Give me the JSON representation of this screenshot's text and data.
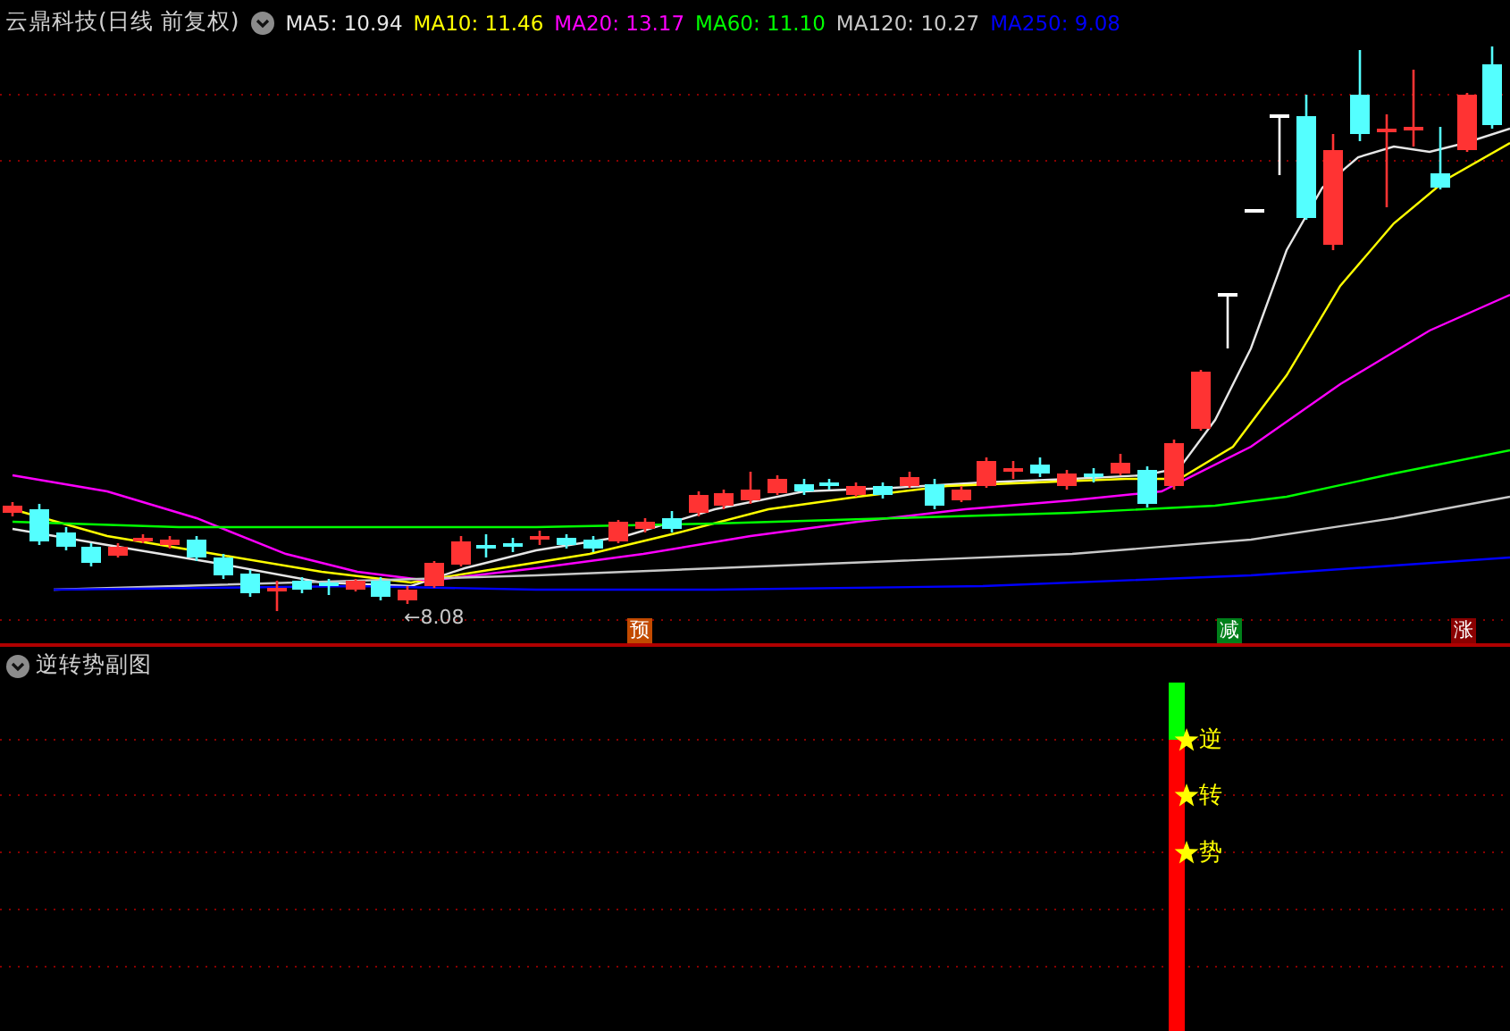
{
  "chart_title": "云鼎科技(日线 前复权)",
  "legend": [
    {
      "label": "MA5: 10.94",
      "color": "#e6e6e6"
    },
    {
      "label": "MA10: 11.46",
      "color": "#ffff00"
    },
    {
      "label": "MA20: 13.17",
      "color": "#ff00ff"
    },
    {
      "label": "MA60: 11.10",
      "color": "#00ff00"
    },
    {
      "label": "MA120: 10.27",
      "color": "#c8c8c8"
    },
    {
      "label": "MA250: 9.08",
      "color": "#0000ff"
    }
  ],
  "low_label": "←8.08",
  "markers": [
    {
      "label": "预",
      "color": "#c24a00"
    },
    {
      "label": "减",
      "color": "#00801a"
    },
    {
      "label": "涨",
      "color": "#8a0000"
    }
  ],
  "sub_chart": {
    "title": "逆转势副图",
    "signals": [
      {
        "label": "逆"
      },
      {
        "label": "转"
      },
      {
        "label": "势"
      }
    ]
  }
}
